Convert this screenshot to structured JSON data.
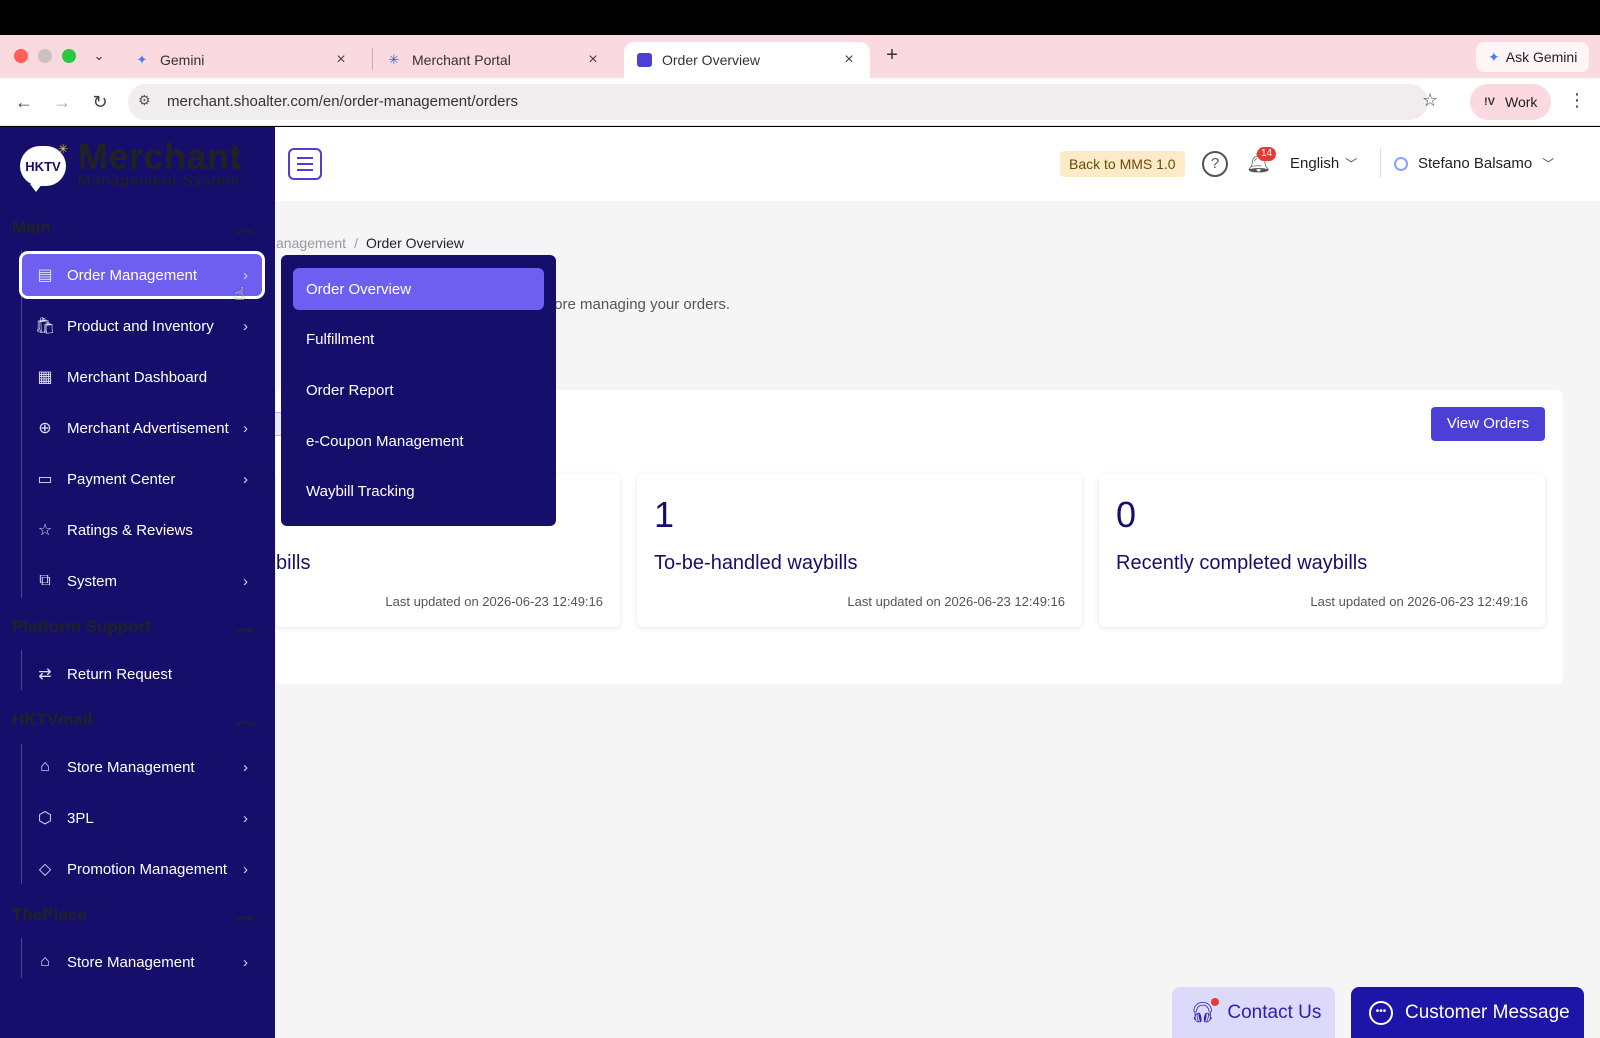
{
  "browser": {
    "tabs": [
      {
        "title": "Gemini",
        "icon": "gemini-icon"
      },
      {
        "title": "Merchant Portal",
        "icon": "portal-icon"
      },
      {
        "title": "Order Overview",
        "icon": "chat-icon",
        "active": true
      }
    ],
    "ask_gemini": "Ask Gemini",
    "url": "merchant.shoalter.com/en/order-management/orders",
    "profile": "Work"
  },
  "sidebar": {
    "logo_title": "Merchant",
    "logo_subtitle": "Management System",
    "logo_badge": "HKTV",
    "sections": [
      {
        "title": "Main",
        "items": [
          {
            "label": "Order Management",
            "icon": "order-icon",
            "has_submenu": true,
            "active": true
          },
          {
            "label": "Product and Inventory",
            "icon": "bag-icon",
            "has_submenu": true
          },
          {
            "label": "Merchant Dashboard",
            "icon": "dashboard-icon",
            "has_submenu": false
          },
          {
            "label": "Merchant Advertisement",
            "icon": "plus-circle-icon",
            "has_submenu": true
          },
          {
            "label": "Payment Center",
            "icon": "card-icon",
            "has_submenu": true
          },
          {
            "label": "Ratings & Reviews",
            "icon": "star-icon",
            "has_submenu": false
          },
          {
            "label": "System",
            "icon": "hierarchy-icon",
            "has_submenu": true
          }
        ]
      },
      {
        "title": "Platform Support",
        "items": [
          {
            "label": "Return Request",
            "icon": "return-icon",
            "has_submenu": false
          }
        ]
      },
      {
        "title": "HKTVmall",
        "items": [
          {
            "label": "Store Management",
            "icon": "store-icon",
            "has_submenu": true
          },
          {
            "label": "3PL",
            "icon": "network-icon",
            "has_submenu": true
          },
          {
            "label": "Promotion Management",
            "icon": "tag-icon",
            "has_submenu": true
          }
        ]
      },
      {
        "title": "ThePlace",
        "items": [
          {
            "label": "Store Management",
            "icon": "store-icon",
            "has_submenu": true
          }
        ]
      }
    ]
  },
  "header": {
    "back_button": "Back to MMS 1.0",
    "notifications": "14",
    "language": "English",
    "user": "Stefano Balsamo"
  },
  "breadcrumb": {
    "parent": "anagement",
    "separator": "/",
    "current": "Order Overview"
  },
  "subtitle": "fore managing your orders.",
  "view_orders": "View Orders",
  "cards": [
    {
      "number": "",
      "label": "bills",
      "updated": "Last updated on 2026-06-23 12:49:16"
    },
    {
      "number": "1",
      "label": "To-be-handled waybills",
      "updated": "Last updated on 2026-06-23 12:49:16"
    },
    {
      "number": "0",
      "label": "Recently completed waybills",
      "updated": "Last updated on 2026-06-23 12:49:16"
    }
  ],
  "submenu": [
    {
      "label": "Order Overview",
      "active": true
    },
    {
      "label": "Fulfillment"
    },
    {
      "label": "Order Report"
    },
    {
      "label": "e-Coupon Management"
    },
    {
      "label": "Waybill Tracking"
    }
  ],
  "bottom": {
    "contact": "Contact Us",
    "customer_message": "Customer Message"
  },
  "colors": {
    "sidebar": "#150f6b",
    "accent": "#6e5ff0",
    "primary": "#4b3fd6",
    "tabbar": "#fbd9e0"
  }
}
